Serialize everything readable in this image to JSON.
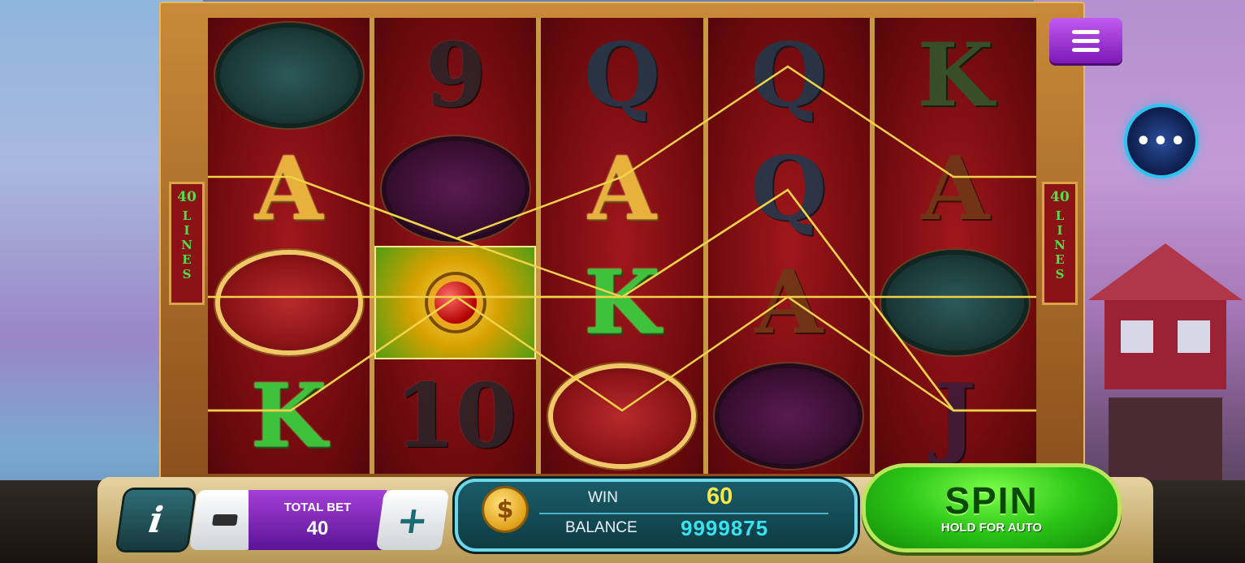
{
  "reels": [
    [
      {
        "kind": "medallion",
        "style": "teal",
        "glyph": ""
      },
      {
        "kind": "letter",
        "text": "A",
        "style": "sym-gold",
        "name": "symbol-a-lotus"
      },
      {
        "kind": "medallion",
        "style": "red",
        "glyph": "",
        "name": "symbol-foo-dog"
      },
      {
        "kind": "letter",
        "text": "K",
        "style": "sym-green",
        "name": "symbol-k-firecracker"
      }
    ],
    [
      {
        "kind": "letter",
        "text": "9",
        "style": "sym-dark",
        "name": "symbol-9"
      },
      {
        "kind": "medallion",
        "style": "purple",
        "glyph": "",
        "name": "symbol-phoenix"
      },
      {
        "kind": "toad",
        "name": "symbol-golden-toad"
      },
      {
        "kind": "letter",
        "text": "10",
        "style": "sym-dark",
        "name": "symbol-10"
      }
    ],
    [
      {
        "kind": "letter",
        "text": "Q",
        "style": "sym-blue",
        "name": "symbol-q"
      },
      {
        "kind": "letter",
        "text": "A",
        "style": "sym-gold",
        "name": "symbol-a-lotus"
      },
      {
        "kind": "letter",
        "text": "K",
        "style": "sym-green",
        "name": "symbol-k-firecracker"
      },
      {
        "kind": "medallion",
        "style": "red",
        "glyph": "",
        "name": "symbol-foo-dog"
      }
    ],
    [
      {
        "kind": "letter",
        "text": "Q",
        "style": "sym-blue",
        "name": "symbol-q"
      },
      {
        "kind": "letter",
        "text": "Q",
        "style": "sym-blue",
        "name": "symbol-q"
      },
      {
        "kind": "letter",
        "text": "A",
        "style": "sym-gold-dim",
        "name": "symbol-a-lotus"
      },
      {
        "kind": "medallion",
        "style": "purple",
        "glyph": "",
        "name": "symbol-phoenix"
      }
    ],
    [
      {
        "kind": "letter",
        "text": "K",
        "style": "sym-green-dim",
        "name": "symbol-k-firecracker"
      },
      {
        "kind": "letter",
        "text": "A",
        "style": "sym-gold-dim",
        "name": "symbol-a-lotus"
      },
      {
        "kind": "medallion",
        "style": "teal",
        "glyph": "",
        "name": "symbol-koi-fish"
      },
      {
        "kind": "letter",
        "text": "J",
        "style": "sym-purple-dim",
        "name": "symbol-j"
      }
    ]
  ],
  "lines_left": {
    "num": "40",
    "word": [
      "L",
      "I",
      "N",
      "E",
      "S"
    ]
  },
  "lines_right": {
    "num": "40",
    "word": [
      "L",
      "I",
      "N",
      "E",
      "S"
    ]
  },
  "bet": {
    "label": "TOTAL BET",
    "value": "40"
  },
  "buttons": {
    "info": "i",
    "minus": "−",
    "plus": "+"
  },
  "win": {
    "label": "WIN",
    "value": "60"
  },
  "balance": {
    "label": "BALANCE",
    "value": "9999875"
  },
  "currency_symbol": "$",
  "spin": {
    "label": "SPIN",
    "sub_label": "HOLD FOR AUTO"
  },
  "more_dots": "•••",
  "colors": {
    "accent_green": "#2cc617",
    "win_yellow": "#f5e64a",
    "balance_cyan": "#39e2ef",
    "bet_purple": "#7a22b8",
    "menu_purple": "#a33ad8"
  }
}
